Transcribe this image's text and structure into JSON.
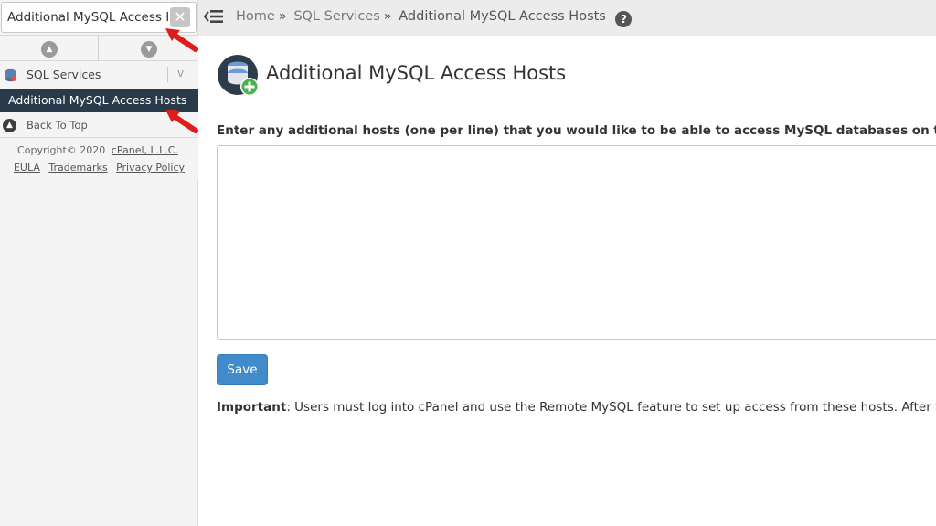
{
  "sidebar": {
    "search": {
      "value": "Additional MySQL Access Hosts",
      "clear_icon": "close-icon"
    },
    "controls": {
      "expand_icon": "chevron-up-icon",
      "collapse_icon": "chevron-down-icon"
    },
    "category": {
      "label": "SQL Services",
      "icon": "database-icon",
      "chevron": "v"
    },
    "active_item": {
      "label": "Additional MySQL Access Hosts"
    },
    "back_to_top": {
      "label": "Back To Top",
      "icon": "arrow-up-icon"
    },
    "footer": {
      "copyright_prefix": "Copyright© 2020 ",
      "copyright_link": "cPanel, L.L.C.",
      "links": [
        "EULA",
        "Trademarks",
        "Privacy Policy"
      ]
    }
  },
  "breadcrumb": {
    "items": [
      "Home",
      "SQL Services",
      "Additional MySQL Access Hosts"
    ],
    "separator": "»",
    "help": "?"
  },
  "main": {
    "title": "Additional MySQL Access Hosts",
    "instructions": "Enter any additional hosts (one per line) that you would like to be able to access MySQL databases on this, or the",
    "textarea_value": "",
    "save_label": "Save",
    "important_label": "Important",
    "important_text": ": Users must log into cPanel and use the Remote MySQL feature to set up access from these hosts. After you h"
  },
  "colors": {
    "active_item_bg": "#293a4a",
    "save_button": "#428bca",
    "annotation_arrow": "#e01b1b"
  }
}
